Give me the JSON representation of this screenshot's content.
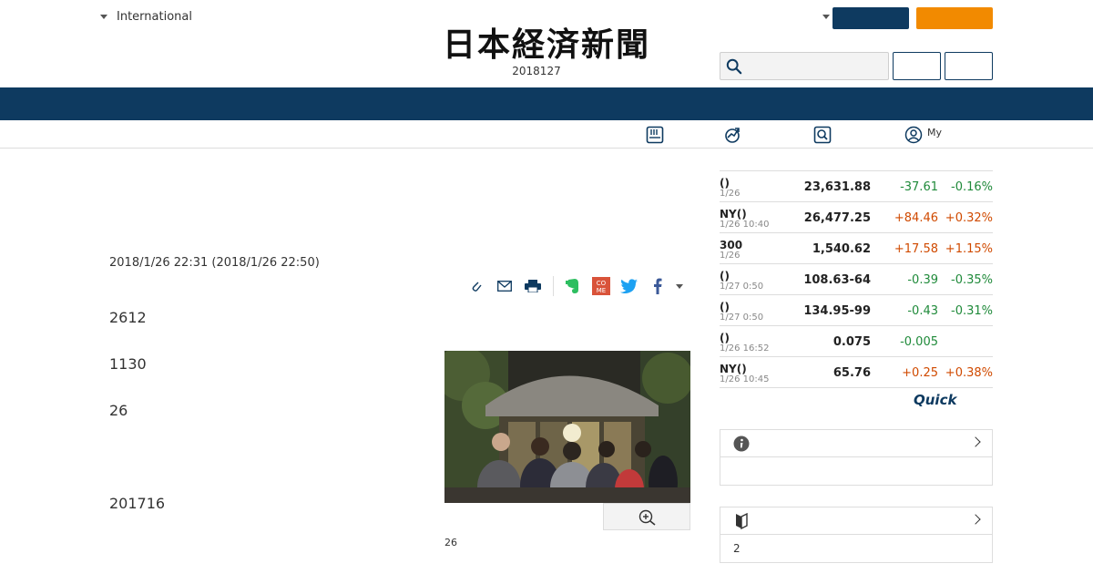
{
  "header": {
    "region_label": "International",
    "logo_text": "日本経済新聞",
    "date": "2018127"
  },
  "subnav": {
    "my_label": "My"
  },
  "article": {
    "published": "2018/1/26 22:31 (2018/1/26 22:50)",
    "paragraphs": [
      "2612",
      "1130",
      "26",
      "201716"
    ],
    "photo_caption": "26"
  },
  "market": {
    "rows": [
      {
        "name": "()",
        "time": "1/26",
        "value": "23,631.88",
        "change": "-37.61",
        "pct": "-0.16%",
        "dir": "down"
      },
      {
        "name": "NY()",
        "time": "1/26 10:40",
        "value": "26,477.25",
        "change": "+84.46",
        "pct": "+0.32%",
        "dir": "up"
      },
      {
        "name": "300",
        "time": "1/26",
        "value": "1,540.62",
        "change": "+17.58",
        "pct": "+1.15%",
        "dir": "up"
      },
      {
        "name": "()",
        "time": "1/27 0:50",
        "value": "108.63-64",
        "change": "-0.39",
        "pct": "-0.35%",
        "dir": "down"
      },
      {
        "name": "()",
        "time": "1/27 0:50",
        "value": "134.95-99",
        "change": "-0.43",
        "pct": "-0.31%",
        "dir": "down"
      },
      {
        "name": "()",
        "time": "1/26 16:52",
        "value": "0.075",
        "change": "-0.005",
        "pct": "",
        "dir": "down"
      },
      {
        "name": "NY()",
        "time": "1/26 10:45",
        "value": "65.76",
        "change": "+0.25",
        "pct": "+0.38%",
        "dir": "up"
      }
    ],
    "provider": "Quick"
  },
  "side_box_2": {
    "body_text": "2"
  },
  "colors": {
    "navy": "#0e3a60",
    "orange": "#f28a00",
    "down": "#1f8a3a",
    "up": "#d04a00"
  }
}
